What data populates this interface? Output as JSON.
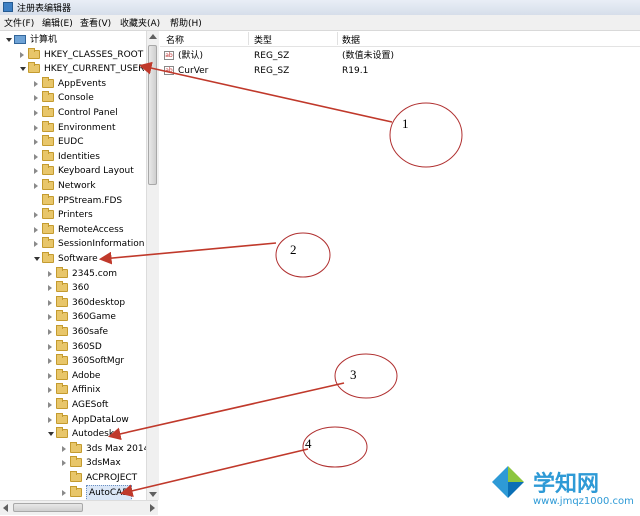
{
  "window": {
    "title": "注册表编辑器"
  },
  "menu": [
    "文件(F)",
    "编辑(E)",
    "查看(V)",
    "收藏夹(A)",
    "帮助(H)"
  ],
  "tree": [
    {
      "label": "计算机",
      "state": "open",
      "icon": "computer-icon"
    },
    {
      "label": "HKEY_CLASSES_ROOT",
      "state": "closed"
    },
    {
      "label": "HKEY_CURRENT_USER",
      "state": "open"
    },
    {
      "label": "AppEvents",
      "state": "closed"
    },
    {
      "label": "Console",
      "state": "closed"
    },
    {
      "label": "Control Panel",
      "state": "closed"
    },
    {
      "label": "Environment",
      "state": "closed"
    },
    {
      "label": "EUDC",
      "state": "closed"
    },
    {
      "label": "Identities",
      "state": "closed"
    },
    {
      "label": "Keyboard Layout",
      "state": "closed"
    },
    {
      "label": "Network",
      "state": "closed"
    },
    {
      "label": "PPStream.FDS",
      "state": "none"
    },
    {
      "label": "Printers",
      "state": "closed"
    },
    {
      "label": "RemoteAccess",
      "state": "closed"
    },
    {
      "label": "SessionInformation",
      "state": "closed"
    },
    {
      "label": "Software",
      "state": "open"
    },
    {
      "label": "2345.com",
      "state": "closed"
    },
    {
      "label": "360",
      "state": "closed"
    },
    {
      "label": "360desktop",
      "state": "closed"
    },
    {
      "label": "360Game",
      "state": "closed"
    },
    {
      "label": "360safe",
      "state": "closed"
    },
    {
      "label": "360SD",
      "state": "closed"
    },
    {
      "label": "360SoftMgr",
      "state": "closed"
    },
    {
      "label": "Adobe",
      "state": "closed"
    },
    {
      "label": "Affinix",
      "state": "closed"
    },
    {
      "label": "AGESoft",
      "state": "closed"
    },
    {
      "label": "AppDataLow",
      "state": "closed"
    },
    {
      "label": "Autodesk",
      "state": "open"
    },
    {
      "label": "3ds Max 2014",
      "state": "closed"
    },
    {
      "label": "3dsMax",
      "state": "closed"
    },
    {
      "label": "ACPROJECT",
      "state": "none"
    },
    {
      "label": "AutoCAD",
      "state": "closed",
      "selected": true
    }
  ],
  "columns": [
    "名称",
    "类型",
    "数据"
  ],
  "values": [
    {
      "name": "(默认)",
      "type": "REG_SZ",
      "data": "(数值未设置)"
    },
    {
      "name": "CurVer",
      "type": "REG_SZ",
      "data": "R19.1"
    }
  ],
  "annotations": [
    "1",
    "2",
    "3",
    "4"
  ],
  "watermark": {
    "text": "学知网",
    "url": "www.jmqz1000.com"
  },
  "colors": {
    "arrow": "#c0392b",
    "circle": "#b03030",
    "watermark": "#2e9ad6"
  }
}
